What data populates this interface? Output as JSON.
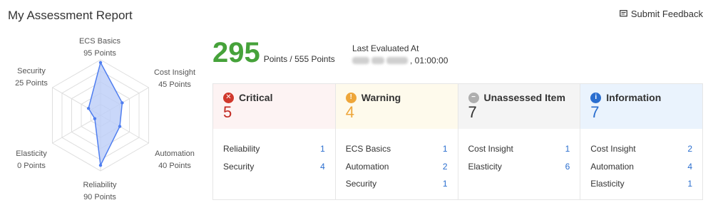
{
  "header": {
    "title": "My Assessment Report",
    "feedback_label": "Submit Feedback"
  },
  "radar": {
    "axes": [
      {
        "name": "ECS Basics",
        "points": "95 Points",
        "value": 95
      },
      {
        "name": "Cost Insight",
        "points": "45 Points",
        "value": 45
      },
      {
        "name": "Automation",
        "points": "40 Points",
        "value": 40
      },
      {
        "name": "Reliability",
        "points": "90 Points",
        "value": 90
      },
      {
        "name": "Elasticity",
        "points": "0 Points",
        "value": 0
      },
      {
        "name": "Security",
        "points": "25 Points",
        "value": 25
      }
    ],
    "max": 100,
    "fill_color": "#bccdf7",
    "stroke_color": "#4f7ef0"
  },
  "score": {
    "value": "295",
    "suffix": "Points / 555 Points",
    "color": "#46a23a"
  },
  "last_evaluated": {
    "label": "Last Evaluated At",
    "time": ", 01:00:00"
  },
  "cards": [
    {
      "title": "Critical",
      "count": "5",
      "icon": "close-icon",
      "icon_color": "#d0382c",
      "bg": "#fdf3f3",
      "count_color": "#c22a22",
      "items": [
        {
          "label": "Reliability",
          "value": "1"
        },
        {
          "label": "Security",
          "value": "4"
        }
      ]
    },
    {
      "title": "Warning",
      "count": "4",
      "icon": "exclamation-icon",
      "icon_color": "#eea63a",
      "bg": "#fefaec",
      "count_color": "#eea63a",
      "items": [
        {
          "label": "ECS Basics",
          "value": "1"
        },
        {
          "label": "Automation",
          "value": "2"
        },
        {
          "label": "Security",
          "value": "1"
        }
      ]
    },
    {
      "title": "Unassessed Item",
      "count": "7",
      "icon": "minus-icon",
      "icon_color": "#aeaeae",
      "bg": "#f4f4f4",
      "count_color": "#333333",
      "items": [
        {
          "label": "Cost Insight",
          "value": "1"
        },
        {
          "label": "Elasticity",
          "value": "6"
        }
      ]
    },
    {
      "title": "Information",
      "count": "7",
      "icon": "info-icon",
      "icon_color": "#2a6ecf",
      "bg": "#eaf3fd",
      "count_color": "#2a6ecf",
      "items": [
        {
          "label": "Cost Insight",
          "value": "2"
        },
        {
          "label": "Automation",
          "value": "4"
        },
        {
          "label": "Elasticity",
          "value": "1"
        }
      ]
    }
  ]
}
